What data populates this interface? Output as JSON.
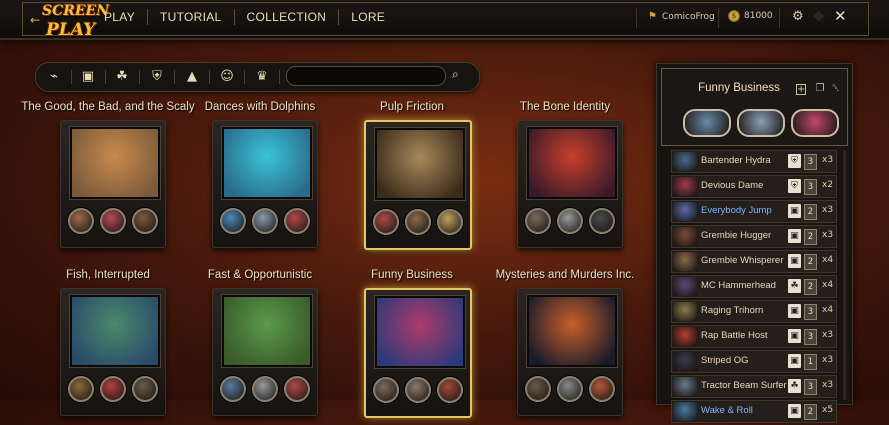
{
  "app": {
    "logo_line1": "SCREEN",
    "logo_line2": "PLAY"
  },
  "nav": {
    "items": [
      "PLAY",
      "TUTORIAL",
      "COLLECTION",
      "LORE"
    ]
  },
  "account": {
    "username": "ComicoFrog",
    "coins": "81000"
  },
  "filters": {
    "icons": [
      "gun-icon",
      "card-icon",
      "creature-icon",
      "shield-icon",
      "pyramid-icon",
      "mask-icon",
      "crown-icon"
    ],
    "search_value": ""
  },
  "decks": [
    {
      "title": "The Good, the Bad, and the Scaly",
      "colors": [
        "#c98a4c",
        "#7a5a3a"
      ],
      "selected": false,
      "avatars": [
        "#9b6b4a",
        "#b8485a",
        "#7a5a3a"
      ]
    },
    {
      "title": "Dances with Dolphins",
      "colors": [
        "#3ac4d8",
        "#2a6a8a"
      ],
      "selected": false,
      "avatars": [
        "#4a8ab8",
        "#8a9aa8",
        "#b04a4a"
      ]
    },
    {
      "title": "Pulp Friction",
      "colors": [
        "#a88a5a",
        "#3a2a1a"
      ],
      "selected": true,
      "avatars": [
        "#a84a4a",
        "#8a6a4a",
        "#c0a060"
      ]
    },
    {
      "title": "The Bone Identity",
      "colors": [
        "#c8402a",
        "#3a1a2a"
      ],
      "selected": false,
      "avatars": [
        "#7a6a5a",
        "#9a9a9a",
        "#4a4a4a"
      ]
    },
    {
      "title": "Fish, Interrupted",
      "colors": [
        "#4a8a6a",
        "#2a4a6a"
      ],
      "selected": false,
      "avatars": [
        "#8a6a3a",
        "#b04040",
        "#6a5a4a"
      ]
    },
    {
      "title": "Fast & Opportunistic",
      "colors": [
        "#5a9a4a",
        "#3a5a2a"
      ],
      "selected": false,
      "avatars": [
        "#5a7a9a",
        "#9a9a9a",
        "#b04a4a"
      ]
    },
    {
      "title": "Funny Business",
      "colors": [
        "#b03a6a",
        "#2a3a7a"
      ],
      "selected": true,
      "avatars": [
        "#7a6a5a",
        "#8a7a6a",
        "#a04a3a"
      ]
    },
    {
      "title": "Mysteries and Murders Inc.",
      "colors": [
        "#c8602a",
        "#1a1a2a"
      ],
      "selected": false,
      "avatars": [
        "#6a5a4a",
        "#8a8a8a",
        "#b05a3a"
      ]
    }
  ],
  "deck_panel": {
    "title": "Funny Business",
    "hero_colors": [
      "#6a8aa8",
      "#8aa0b8",
      "#c04a6a"
    ],
    "cards": [
      {
        "name": "Bartender Hydra",
        "type_icon": "shield-icon",
        "cost": "3",
        "count": "x3",
        "blue": false,
        "thumb": "#4a6a8a"
      },
      {
        "name": "Devious Dame",
        "type_icon": "shield-icon",
        "cost": "3",
        "count": "x2",
        "blue": false,
        "thumb": "#a03a4a"
      },
      {
        "name": "Everybody Jump",
        "type_icon": "card-icon",
        "cost": "2",
        "count": "x3",
        "blue": true,
        "thumb": "#5a6aa8"
      },
      {
        "name": "Grembie Hugger",
        "type_icon": "card-icon",
        "cost": "2",
        "count": "x3",
        "blue": false,
        "thumb": "#7a4a3a"
      },
      {
        "name": "Grembie Whisperer",
        "type_icon": "card-icon",
        "cost": "2",
        "count": "x4",
        "blue": false,
        "thumb": "#8a6a4a"
      },
      {
        "name": "MC Hammerhead",
        "type_icon": "creature-icon",
        "cost": "2",
        "count": "x4",
        "blue": false,
        "thumb": "#5a4a7a"
      },
      {
        "name": "Raging Trihorn",
        "type_icon": "card-icon",
        "cost": "3",
        "count": "x4",
        "blue": false,
        "thumb": "#8a7a4a"
      },
      {
        "name": "Rap Battle Host",
        "type_icon": "card-icon",
        "cost": "3",
        "count": "x3",
        "blue": false,
        "thumb": "#b04030"
      },
      {
        "name": "Striped OG",
        "type_icon": "card-icon",
        "cost": "1",
        "count": "x3",
        "blue": false,
        "thumb": "#3a3a4a"
      },
      {
        "name": "Tractor Beam Surfer",
        "type_icon": "creature-icon",
        "cost": "3",
        "count": "x3",
        "blue": false,
        "thumb": "#6a7a8a"
      },
      {
        "name": "Wake & Roll",
        "type_icon": "card-icon",
        "cost": "2",
        "count": "x5",
        "blue": true,
        "thumb": "#4a7aa0"
      }
    ]
  }
}
